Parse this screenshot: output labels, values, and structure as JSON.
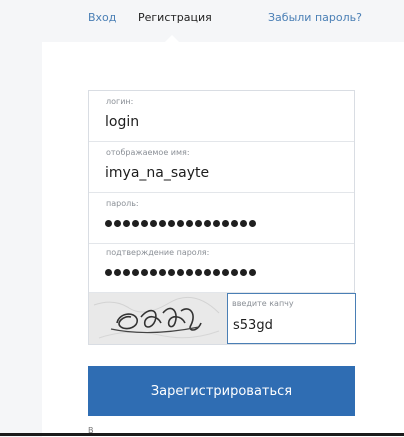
{
  "tabs": {
    "login": "Вход",
    "register": "Регистрация",
    "forgot": "Забыли пароль?"
  },
  "form": {
    "login": {
      "label": "логин:",
      "value": "login"
    },
    "display_name": {
      "label": "отображаемое имя:",
      "value": "imya_na_sayte"
    },
    "password": {
      "label": "пароль:",
      "masked_length": 17
    },
    "password_confirm": {
      "label": "подтверждение пароля:",
      "masked_length": 17
    },
    "captcha": {
      "label": "введите капчу",
      "value": "s53gd"
    }
  },
  "submit_label": "Зарегистрироваться",
  "below_text": "В",
  "colors": {
    "accent": "#2f6db3",
    "link": "#4a7fb5"
  }
}
